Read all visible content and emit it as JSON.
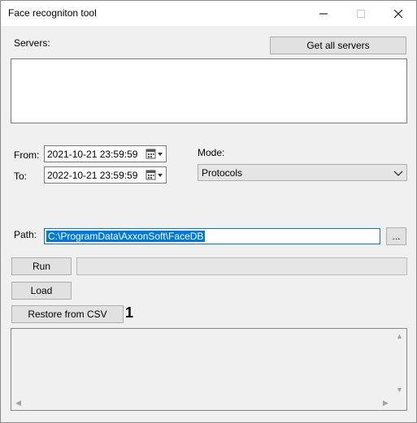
{
  "window": {
    "title": "Face recogniton tool",
    "controls": {
      "minimize": "—",
      "maximize": "☐",
      "close": "✕"
    }
  },
  "servers": {
    "label": "Servers:",
    "get_all_button": "Get all servers",
    "items": []
  },
  "dates": {
    "from_label": "From:",
    "from_value": "2021-10-21 23:59:59",
    "to_label": "To:",
    "to_value": "2022-10-21 23:59:59"
  },
  "mode": {
    "label": "Mode:",
    "selected": "Protocols"
  },
  "path": {
    "label": "Path:",
    "value": "C:\\ProgramData\\AxxonSoft\\FaceDB",
    "browse_button": "..."
  },
  "actions": {
    "run": "Run",
    "load": "Load",
    "restore": "Restore from CSV",
    "annotation_marker": "1"
  },
  "colors": {
    "accent": "#0078d7",
    "window_bg": "#f0f0f0",
    "button_bg": "#e1e1e1"
  }
}
